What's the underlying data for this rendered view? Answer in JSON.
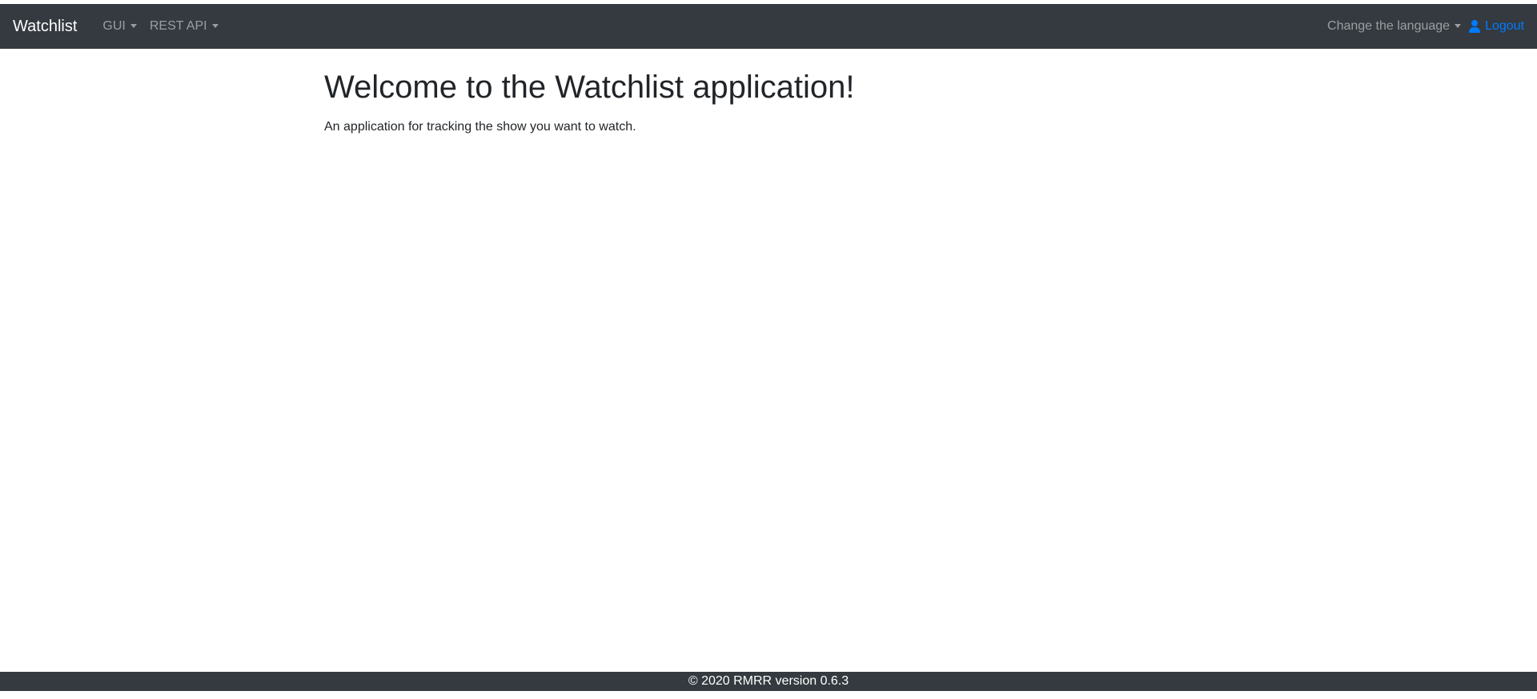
{
  "navbar": {
    "brand": "Watchlist",
    "items": [
      {
        "label": "GUI"
      },
      {
        "label": "REST API"
      }
    ],
    "language_label": "Change the language",
    "logout_label": "Logout",
    "logout_icon": "user-icon"
  },
  "main": {
    "title": "Welcome to the Watchlist application!",
    "subtitle": "An application for tracking the show you want to watch."
  },
  "footer": {
    "text": "© 2020 RMRR version 0.6.3"
  },
  "colors": {
    "navbar_bg": "#343a40",
    "link_accent": "#007bff",
    "nav_muted": "rgba(255,255,255,0.5)"
  }
}
